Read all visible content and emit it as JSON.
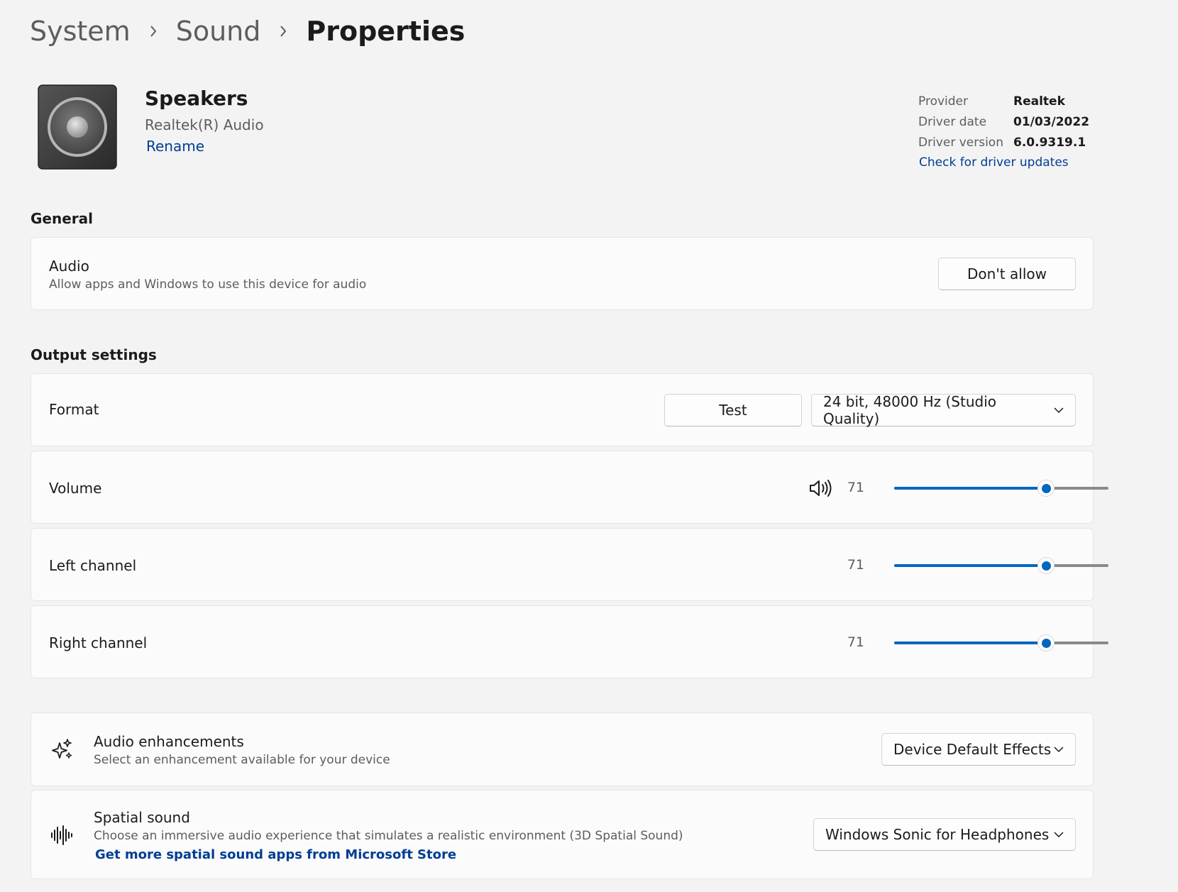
{
  "breadcrumb": {
    "items": [
      "System",
      "Sound"
    ],
    "current": "Properties"
  },
  "device": {
    "name": "Speakers",
    "subtitle": "Realtek(R) Audio",
    "rename_label": "Rename",
    "icon": "speaker-icon"
  },
  "driver": {
    "provider_label": "Provider",
    "provider": "Realtek",
    "date_label": "Driver date",
    "date": "01/03/2022",
    "version_label": "Driver version",
    "version": "6.0.9319.1",
    "update_link": "Check for driver updates"
  },
  "general": {
    "heading": "General",
    "audio": {
      "title": "Audio",
      "description": "Allow apps and Windows to use this device for audio",
      "button": "Don't allow"
    }
  },
  "output": {
    "heading": "Output settings",
    "format": {
      "title": "Format",
      "test_button": "Test",
      "selected": "24 bit, 48000 Hz (Studio Quality)"
    },
    "volume": {
      "title": "Volume",
      "value": "71",
      "icon": "speaker-volume-icon"
    },
    "left_channel": {
      "title": "Left channel",
      "value": "71"
    },
    "right_channel": {
      "title": "Right channel",
      "value": "71"
    }
  },
  "enhancements": {
    "title": "Audio enhancements",
    "description": "Select an enhancement available for your device",
    "selected": "Device Default Effects",
    "icon": "sparkle-icon"
  },
  "spatial": {
    "title": "Spatial sound",
    "description": "Choose an immersive audio experience that simulates a realistic environment (3D Spatial Sound)",
    "link": "Get more spatial sound apps from Microsoft Store",
    "selected": "Windows Sonic for Headphones",
    "icon": "spatial-sound-icon"
  },
  "colors": {
    "accent": "#0067c0",
    "link": "#003e92",
    "background": "#f3f3f3",
    "card": "#fbfbfb"
  }
}
